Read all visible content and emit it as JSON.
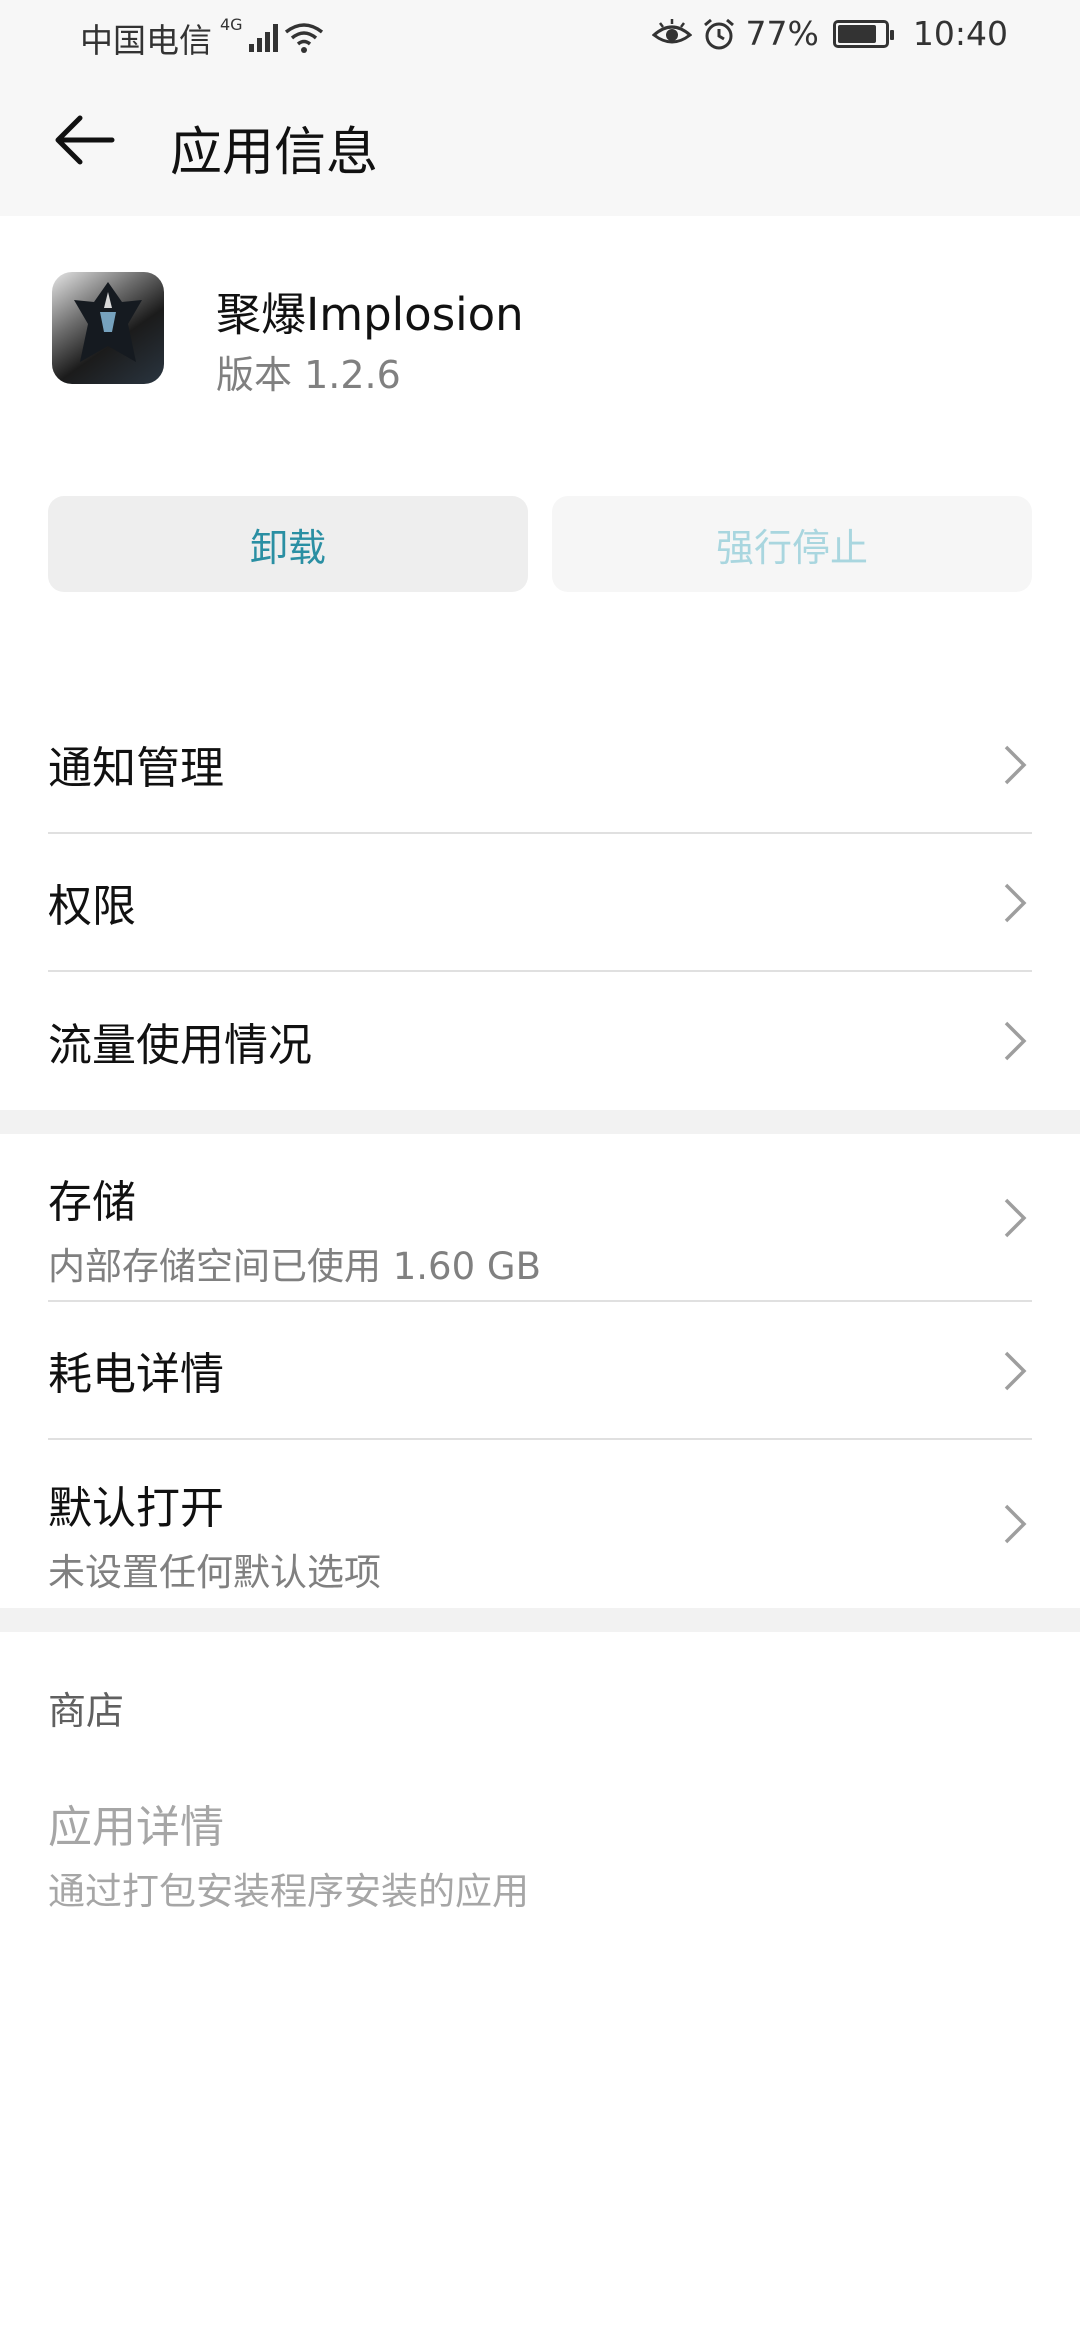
{
  "status_bar": {
    "carrier": "中国电信",
    "network": "4G",
    "battery_percent": "77%",
    "battery_level": 0.77,
    "time": "10:40",
    "icons": [
      "signal-icon",
      "wifi-icon",
      "eye-icon",
      "alarm-icon",
      "battery-icon"
    ]
  },
  "header": {
    "title": "应用信息",
    "back_icon": "back-arrow-icon"
  },
  "app": {
    "name": "聚爆Implosion",
    "version": "版本 1.2.6"
  },
  "buttons": {
    "uninstall": "卸载",
    "force_stop": "强行停止"
  },
  "section1": {
    "items": [
      {
        "title": "通知管理"
      },
      {
        "title": "权限"
      },
      {
        "title": "流量使用情况"
      }
    ]
  },
  "section2": {
    "items": [
      {
        "title": "存储",
        "subtitle": "内部存储空间已使用 1.60 GB"
      },
      {
        "title": "耗电详情"
      },
      {
        "title": "默认打开",
        "subtitle": "未设置任何默认选项"
      }
    ]
  },
  "store": {
    "header": "商店",
    "item_title": "应用详情",
    "item_subtitle": "通过打包安装程序安装的应用"
  },
  "colors": {
    "accent": "#2a8fa3",
    "disabled_accent": "#a9d6df",
    "header_bg": "#f7f7f7"
  }
}
